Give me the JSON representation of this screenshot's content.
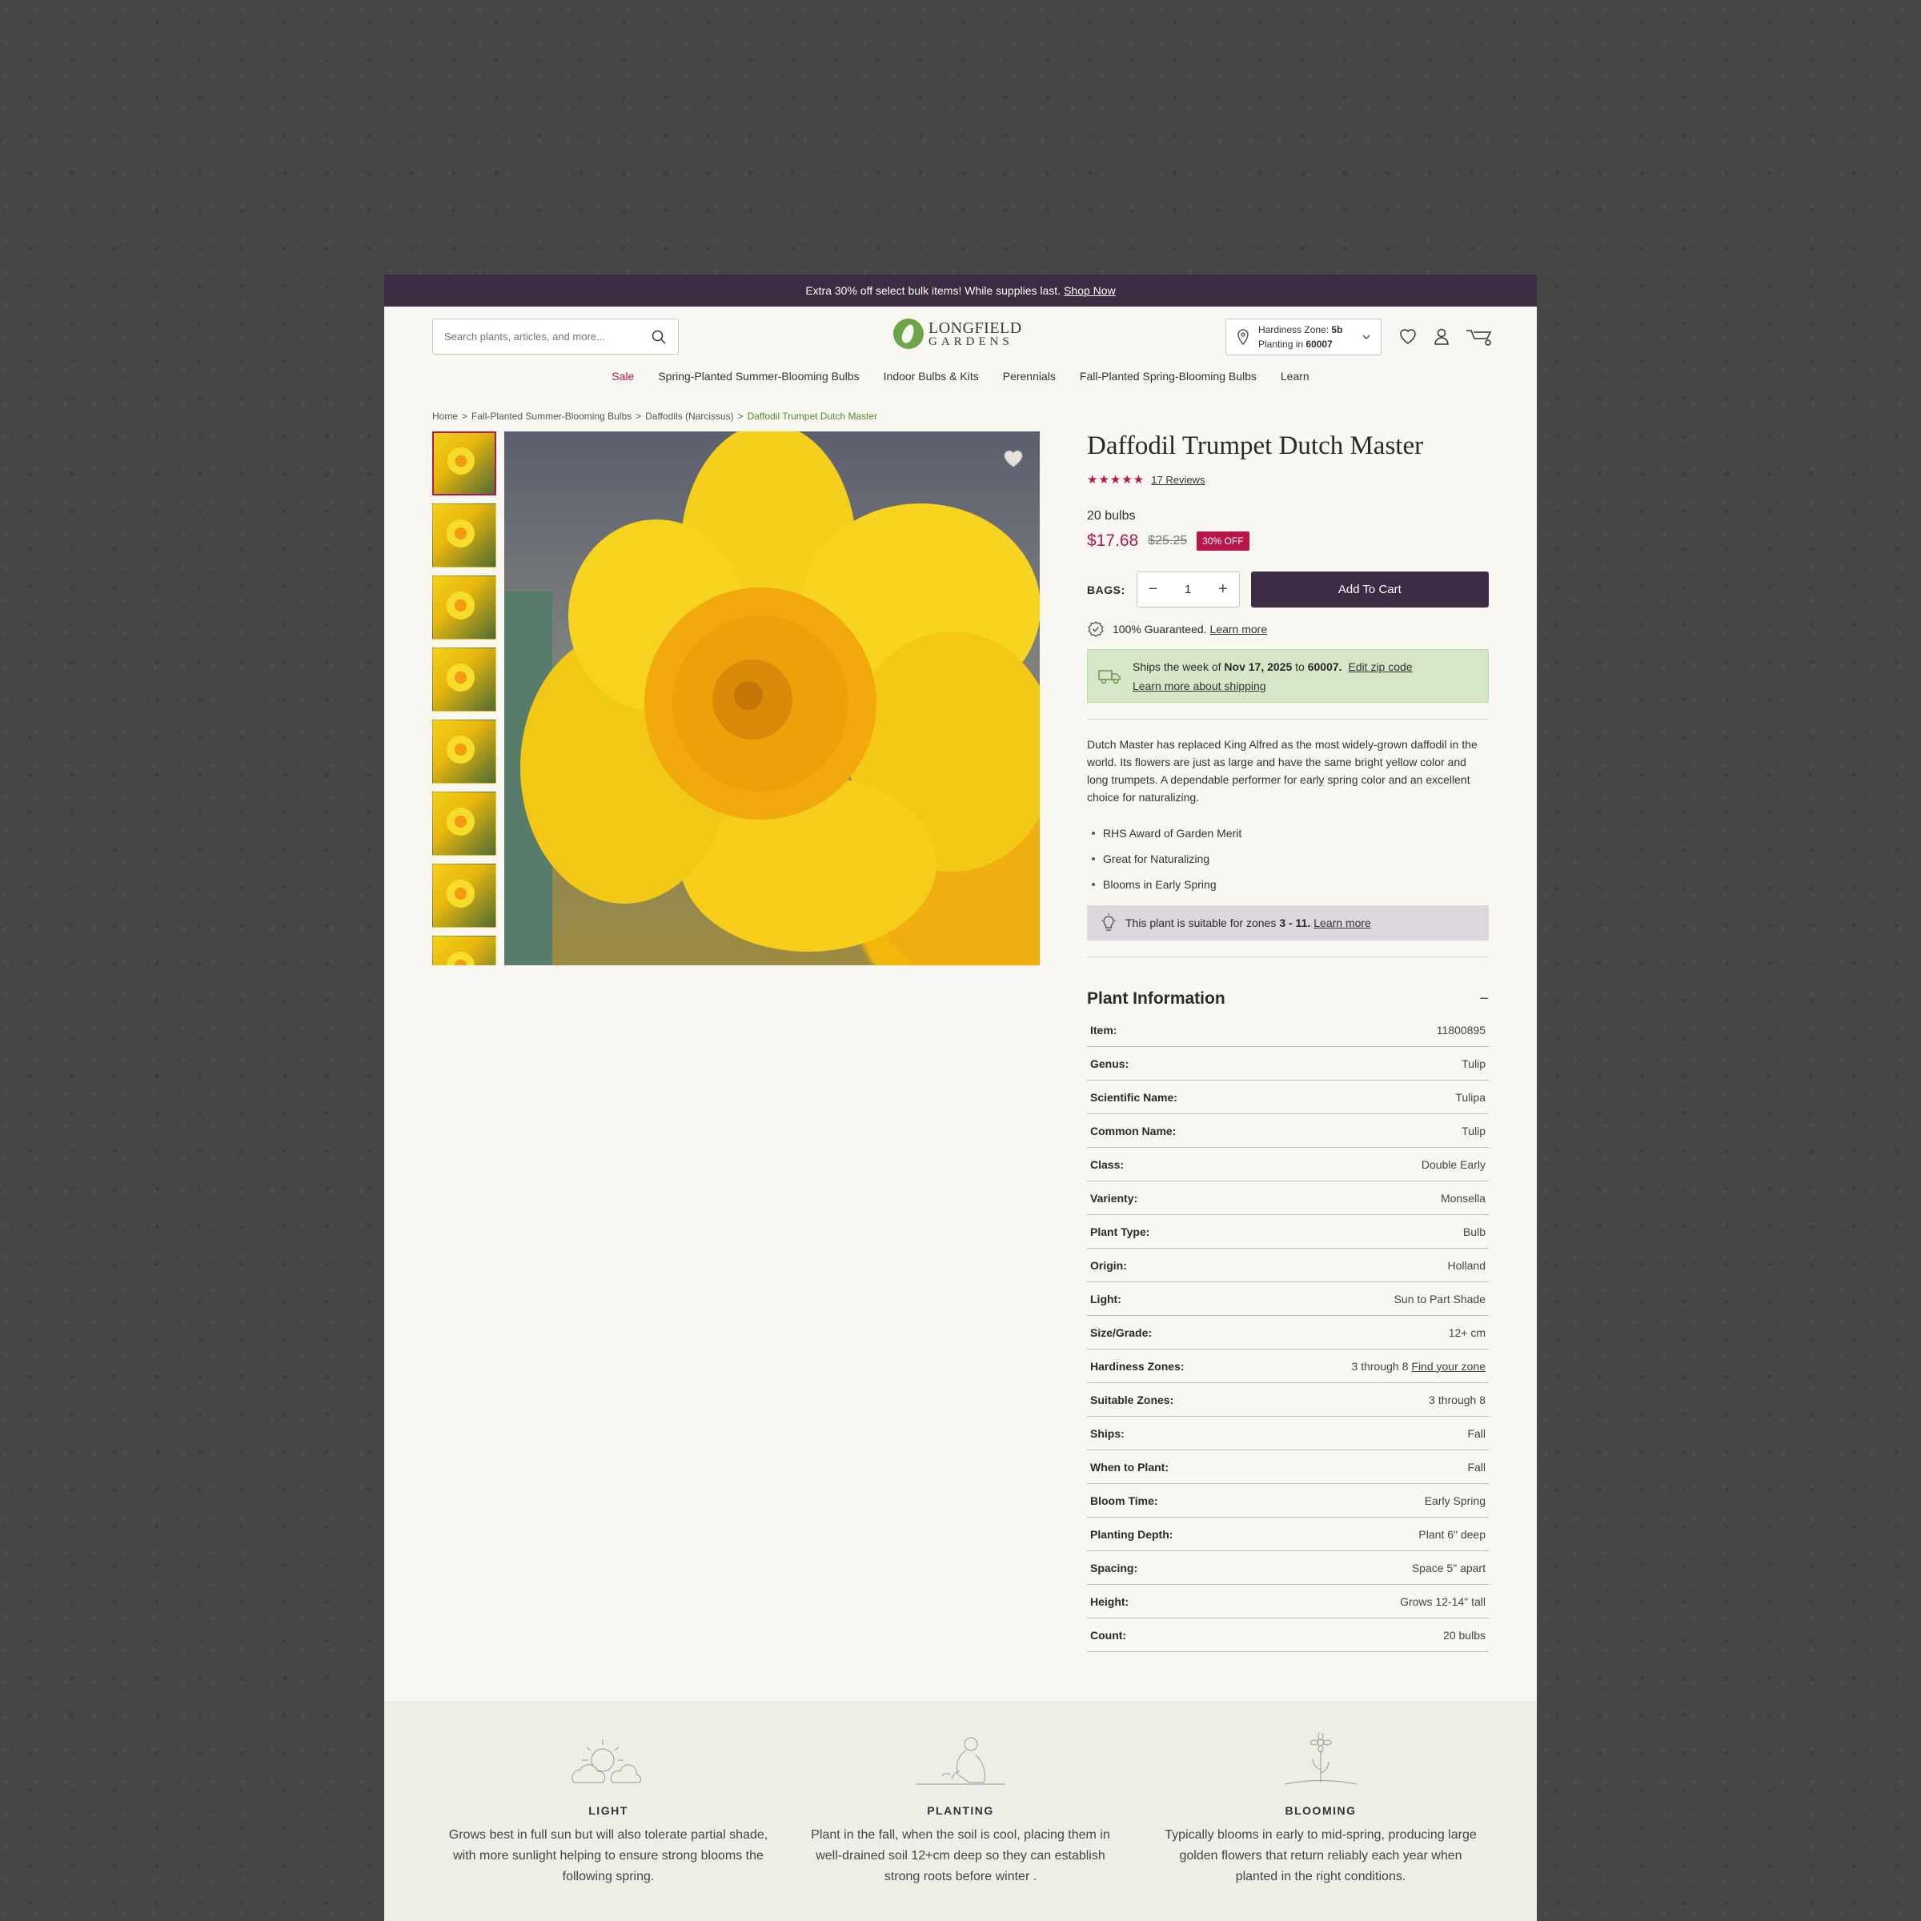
{
  "promo": {
    "text": "Extra 30% off select bulk items! While supplies last.",
    "link": "Shop Now"
  },
  "search": {
    "placeholder": "Search plants, articles, and more..."
  },
  "logo": {
    "line1": "LONGFIELD",
    "line2": "GARDENS"
  },
  "zone": {
    "hardiness_label": "Hardiness Zone:",
    "hardiness_value": "5b",
    "planting_label": "Planting in",
    "planting_value": "60007"
  },
  "nav": [
    "Sale",
    "Spring-Planted Summer-Blooming Bulbs",
    "Indoor Bulbs & Kits",
    "Perennials",
    "Fall-Planted Spring-Blooming Bulbs",
    "Learn"
  ],
  "breadcrumbs": [
    "Home",
    "Fall-Planted Summer-Blooming Bulbs",
    "Daffodils (Narcissus)",
    "Daffodil Trumpet Dutch Master"
  ],
  "breadcrumb_sep": ">",
  "product": {
    "title": "Daffodil Trumpet Dutch Master",
    "stars": "★★★★★",
    "rating": 5,
    "reviews": "17 Reviews",
    "size": "20 bulbs",
    "price": "$17.68",
    "was_price": "$25.25",
    "discount": "30% OFF",
    "qty_label": "BAGS:",
    "qty": "1",
    "minus": "−",
    "plus": "+",
    "add_to_cart": "Add To Cart",
    "guarantee": "100% Guaranteed.",
    "guarantee_link": "Learn more",
    "ship_prefix": "Ships the week of",
    "ship_date": "Nov 17, 2025",
    "ship_to": "to",
    "ship_zip": "60007.",
    "ship_edit": "Edit zip code",
    "ship_learn": "Learn more about shipping",
    "description": "Dutch Master has replaced King Alfred as the most widely-grown daffodil in the world. Its flowers are just as large and have the same bright yellow color and long trumpets. A dependable performer for early spring color and an excellent choice for naturalizing.",
    "bullets": [
      "RHS Award of Garden Merit",
      "Great for Naturalizing",
      "Blooms in Early Spring"
    ],
    "zones_text": "This plant is suitable for zones",
    "zones_value": "3 - 11.",
    "zones_link": "Learn more"
  },
  "plant_info": {
    "title": "Plant Information",
    "toggle": "−",
    "rows": [
      {
        "k": "Item:",
        "v": "11800895"
      },
      {
        "k": "Genus:",
        "v": "Tulip"
      },
      {
        "k": "Scientific Name:",
        "v": "Tulipa"
      },
      {
        "k": "Common Name:",
        "v": "Tulip"
      },
      {
        "k": "Class:",
        "v": "Double Early"
      },
      {
        "k": "Varienty:",
        "v": "Monsella"
      },
      {
        "k": "Plant Type:",
        "v": "Bulb"
      },
      {
        "k": "Origin:",
        "v": "Holland"
      },
      {
        "k": "Light:",
        "v": "Sun to Part Shade"
      },
      {
        "k": "Size/Grade:",
        "v": "12+ cm"
      },
      {
        "k": "Hardiness Zones:",
        "v": "3 through 8",
        "link": "Find your zone"
      },
      {
        "k": "Suitable Zones:",
        "v": "3 through 8"
      },
      {
        "k": "Ships:",
        "v": "Fall"
      },
      {
        "k": "When to Plant:",
        "v": "Fall"
      },
      {
        "k": "Bloom Time:",
        "v": "Early Spring"
      },
      {
        "k": "Planting Depth:",
        "v": "Plant 6\" deep"
      },
      {
        "k": "Spacing:",
        "v": "Space 5\" apart"
      },
      {
        "k": "Height:",
        "v": "Grows 12-14\" tall"
      },
      {
        "k": "Count:",
        "v": "20 bulbs"
      }
    ]
  },
  "features": [
    {
      "title": "LIGHT",
      "icon": "sun-cloud-icon",
      "text": "Grows best in full sun but will also tolerate partial shade, with more sunlight helping to ensure strong blooms the following spring."
    },
    {
      "title": "PLANTING",
      "icon": "gardener-icon",
      "text": "Plant in the fall, when the soil is cool, placing them in well-drained soil 12+cm deep so they can establish strong roots before winter ."
    },
    {
      "title": "BLOOMING",
      "icon": "flower-icon",
      "text": "Typically blooms in early to mid-spring, producing large golden flowers that return reliably each year when planted in the right conditions."
    }
  ],
  "colors": {
    "accent": "#b8164a",
    "brand_dark": "#3d2a43",
    "green": "#6ea54a"
  }
}
